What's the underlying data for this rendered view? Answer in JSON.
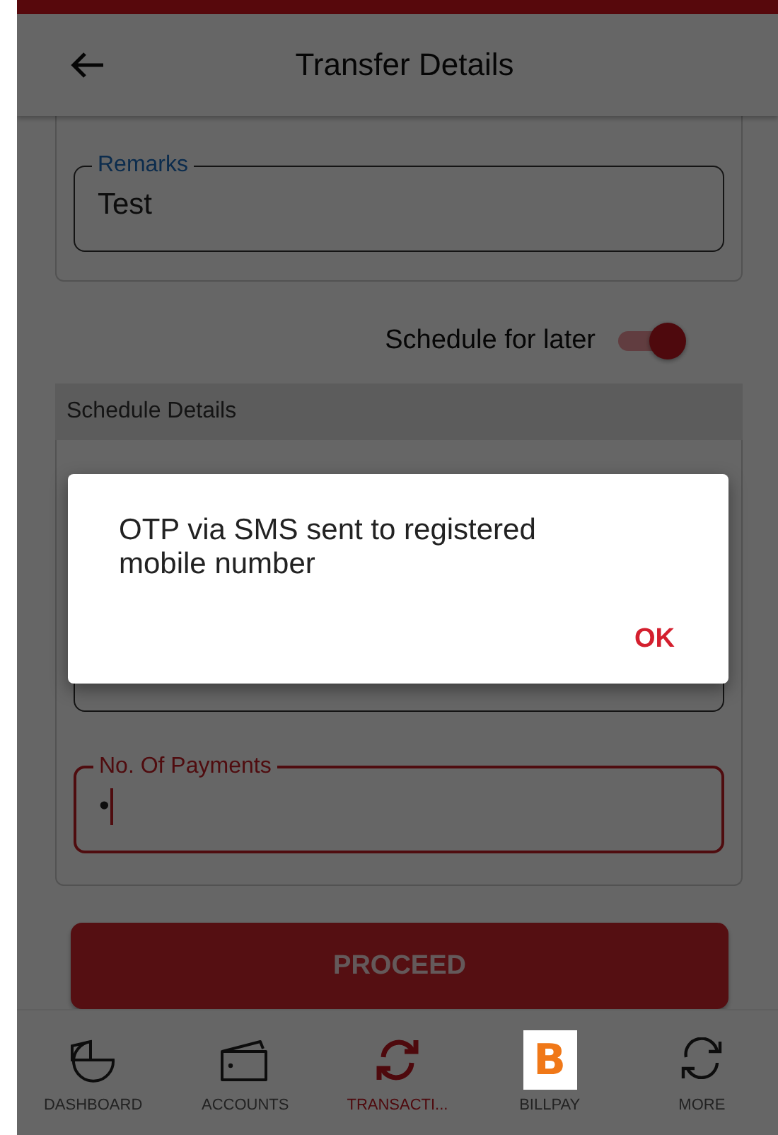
{
  "header": {
    "title": "Transfer Details"
  },
  "remarks_field": {
    "label": "Remarks",
    "value": "Test",
    "focused": false
  },
  "schedule_toggle": {
    "label": "Schedule for later",
    "on": true
  },
  "schedule_section": {
    "title": "Schedule Details"
  },
  "payments_field": {
    "label": "No. Of Payments",
    "value": "•",
    "focused": true
  },
  "proceed_button": {
    "label": "PROCEED"
  },
  "nav": [
    {
      "label": "DASHBOARD",
      "kind": "pie",
      "selected": false
    },
    {
      "label": "ACCOUNTS",
      "kind": "wallet",
      "selected": false
    },
    {
      "label": "TRANSACTI...",
      "kind": "transfer",
      "selected": true
    },
    {
      "label": "BILLPAY",
      "kind": "logo",
      "logo_text": "B",
      "selected": false
    },
    {
      "label": "MORE",
      "kind": "more",
      "selected": false
    }
  ],
  "dialog": {
    "message": "OTP via SMS sent to registered mobile number",
    "button": "OK"
  }
}
